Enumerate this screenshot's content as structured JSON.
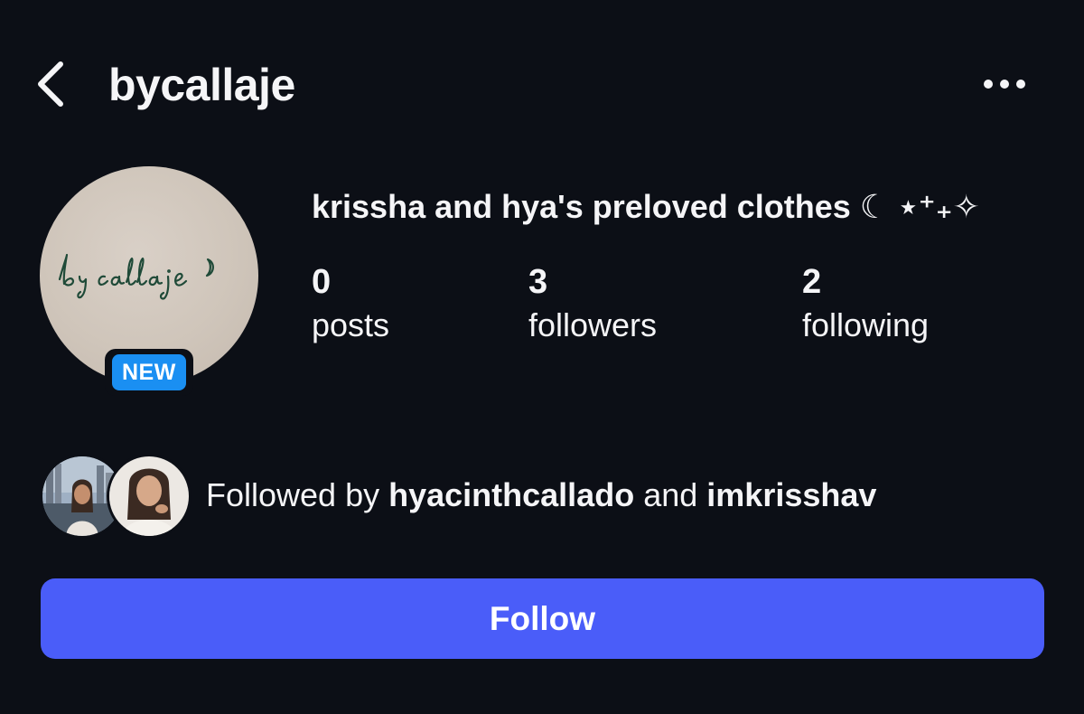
{
  "header": {
    "username": "bycallaje",
    "back_icon": "chevron-left-icon",
    "more_icon": "more-horizontal-icon"
  },
  "profile": {
    "avatar_logo_text": "by callaje",
    "new_badge": "NEW",
    "display_name": "krissha and hya's preloved clothes ☾ ⋆⁺₊✧",
    "stats": [
      {
        "value": "0",
        "label": "posts"
      },
      {
        "value": "3",
        "label": "followers"
      },
      {
        "value": "2",
        "label": "following"
      }
    ]
  },
  "followed_by": {
    "prefix": "Followed by",
    "user1": "hyacinthcallado",
    "conjunction": "and",
    "user2": "imkrisshav"
  },
  "actions": {
    "follow_label": "Follow"
  },
  "colors": {
    "background": "#0c0f16",
    "follow_button": "#4a5df9",
    "badge": "#1a8ff2",
    "text": "#f5f5f7"
  }
}
